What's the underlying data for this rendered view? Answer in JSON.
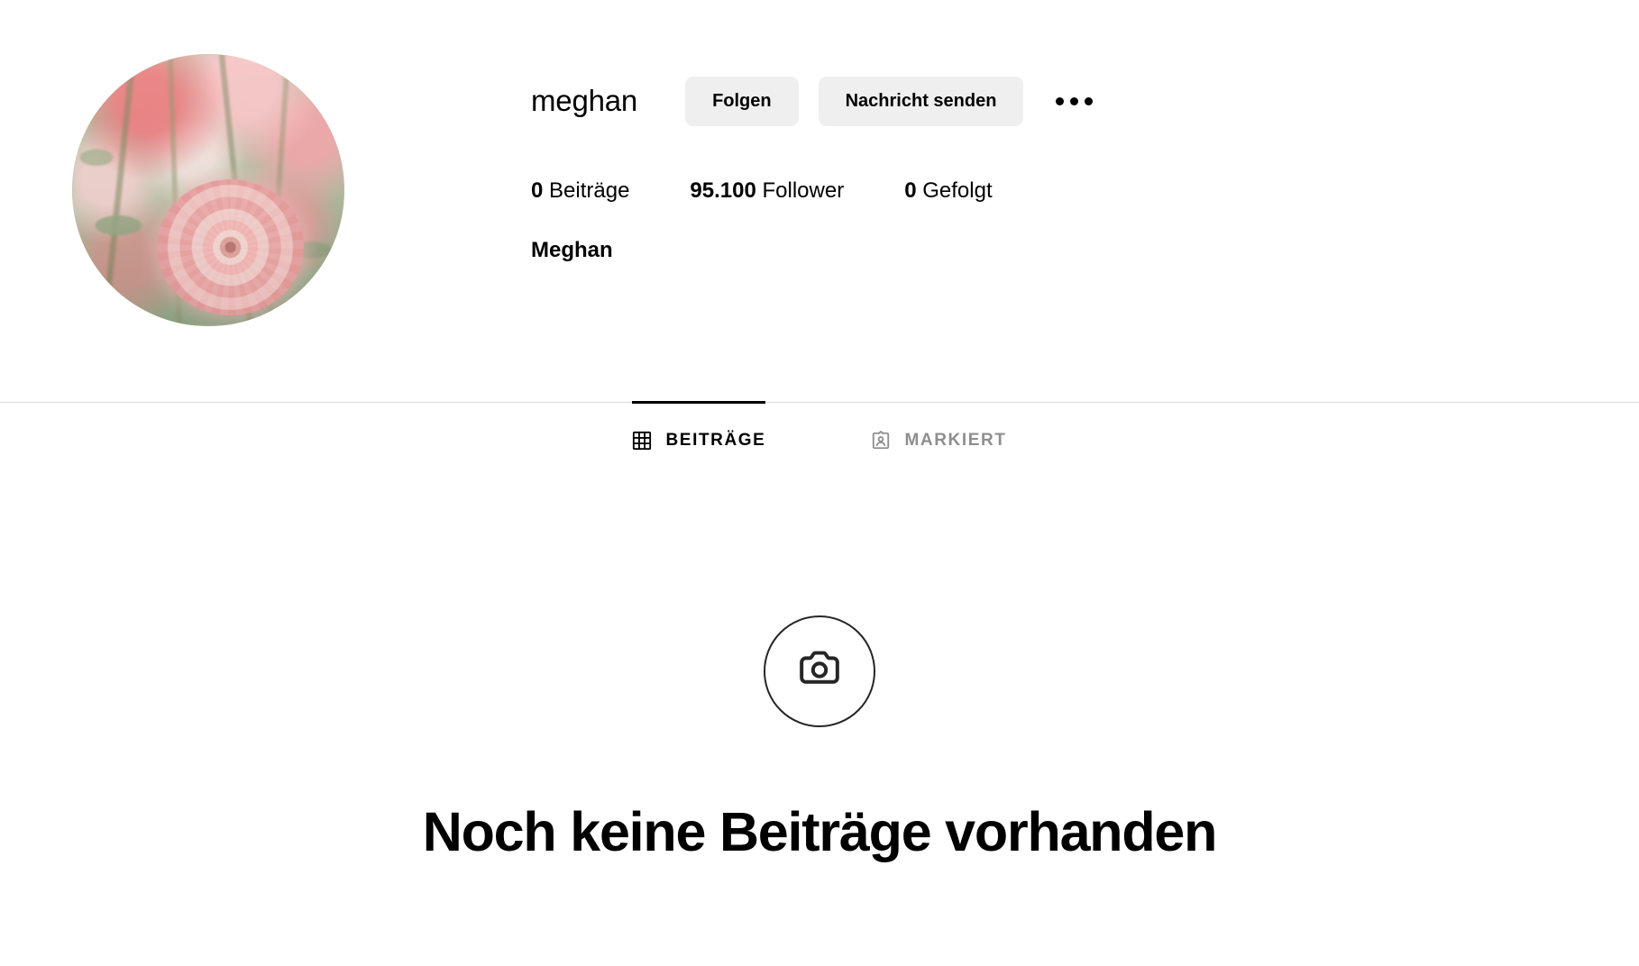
{
  "profile": {
    "username": "meghan",
    "full_name": "Meghan",
    "avatar_alt": "pink-dahlia-flowers-photo",
    "actions": {
      "follow_label": "Folgen",
      "message_label": "Nachricht senden",
      "more_label": "more-options"
    },
    "stats": [
      {
        "id": "posts",
        "value": "0",
        "label": "Beiträge"
      },
      {
        "id": "followers",
        "value": "95.100",
        "label": "Follower"
      },
      {
        "id": "following",
        "value": "0",
        "label": "Gefolgt"
      }
    ]
  },
  "tabs": [
    {
      "id": "posts",
      "label": "BEITRÄGE",
      "icon": "grid-icon",
      "active": true
    },
    {
      "id": "tagged",
      "label": "MARKIERT",
      "icon": "tagged-person-icon",
      "active": false
    }
  ],
  "empty_state": {
    "icon": "camera-icon",
    "title": "Noch keine Beiträge vorhanden"
  },
  "colors": {
    "text_primary": "#000000",
    "text_muted": "#8e8e8e",
    "button_bg": "#efefef",
    "divider": "#dbdbdb",
    "background": "#ffffff"
  }
}
